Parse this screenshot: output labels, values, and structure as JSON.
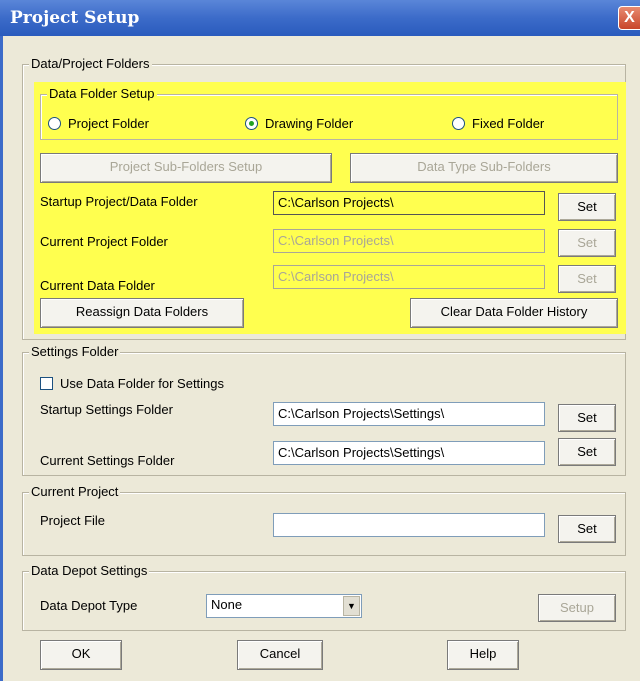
{
  "window": {
    "title": "Project Setup",
    "close_glyph": "X"
  },
  "data_project_folders": {
    "legend": "Data/Project Folders",
    "data_folder_setup": {
      "legend": "Data Folder Setup",
      "options": [
        "Project Folder",
        "Drawing Folder",
        "Fixed Folder"
      ],
      "selected": "Drawing Folder"
    },
    "subfolders_button": "Project Sub-Folders Setup",
    "data_type_button": "Data Type Sub-Folders",
    "startup_label": "Startup Project/Data Folder",
    "startup_value": "C:\\Carlson Projects\\",
    "current_project_label": "Current Project Folder",
    "current_project_value": "C:\\Carlson Projects\\",
    "current_data_label": "Current Data Folder",
    "current_data_value": "C:\\Carlson Projects\\",
    "set_label": "Set",
    "reassign_button": "Reassign Data Folders",
    "clear_history_button": "Clear Data Folder History"
  },
  "settings_folder": {
    "legend": "Settings Folder",
    "use_data_folder_label": "Use Data Folder for Settings",
    "startup_label": "Startup Settings Folder",
    "startup_value": "C:\\Carlson Projects\\Settings\\",
    "current_label": "Current Settings Folder",
    "current_value": "C:\\Carlson Projects\\Settings\\",
    "set_label": "Set"
  },
  "current_project": {
    "legend": "Current Project",
    "project_file_label": "Project File",
    "project_file_value": "",
    "set_label": "Set"
  },
  "data_depot": {
    "legend": "Data Depot Settings",
    "type_label": "Data Depot Type",
    "type_value": "None",
    "setup_button": "Setup"
  },
  "footer": {
    "ok": "OK",
    "cancel": "Cancel",
    "help": "Help"
  },
  "colors": {
    "highlight": "#ffff4f",
    "titlebar": "#3c6bc9",
    "dialog_bg": "#ece9d8"
  }
}
